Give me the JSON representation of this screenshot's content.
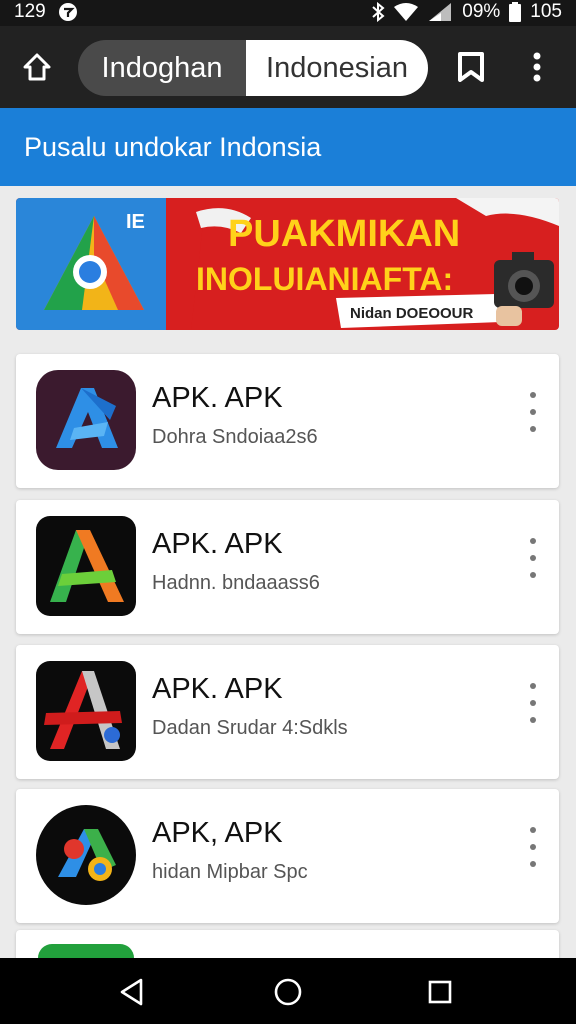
{
  "status_bar": {
    "time": "129",
    "battery_percent": "09%",
    "right_time": "105",
    "icons": [
      "notification-icon",
      "bluetooth-icon",
      "wifi-icon",
      "signal-icon",
      "battery-icon"
    ]
  },
  "toolbar": {
    "home_icon": "home-icon",
    "lang_option_a": "Indoghan",
    "lang_option_b": "Indonesian",
    "bookmark_icon": "bookmark-icon",
    "menu_icon": "more-vert-icon"
  },
  "subheader": {
    "title": "Pusalu undokar Indonsia"
  },
  "banner": {
    "headline_1": "PUAKMIKAN",
    "headline_2": "INOLUIANIAFTA:",
    "caption": "Nidan DOEOOUR",
    "corner_text": "IE",
    "colors": {
      "red": "#d71f1f",
      "yellow": "#ffd21a",
      "white": "#ffffff"
    }
  },
  "apps": [
    {
      "name": "APK. APK",
      "desc": "Dohra Sndoiaa2s6",
      "icon": "blue-a-icon"
    },
    {
      "name": "APK. APK",
      "desc": "Hadnn. bndaaass6",
      "icon": "green-orange-a-icon"
    },
    {
      "name": "APK. APK",
      "desc": "Dadan Srudar 4:Sdkls",
      "icon": "red-a-icon"
    },
    {
      "name": "APK, APK",
      "desc": "hidan Mipbar Spc",
      "icon": "colorful-circle-icon"
    }
  ],
  "nav": {
    "back_icon": "back-icon",
    "home_icon": "home-circle-icon",
    "recents_icon": "recents-icon"
  },
  "colors": {
    "status_bar": "#161616",
    "toolbar": "#222222",
    "accent": "#1b7fd8",
    "page_bg": "#ebebeb"
  }
}
